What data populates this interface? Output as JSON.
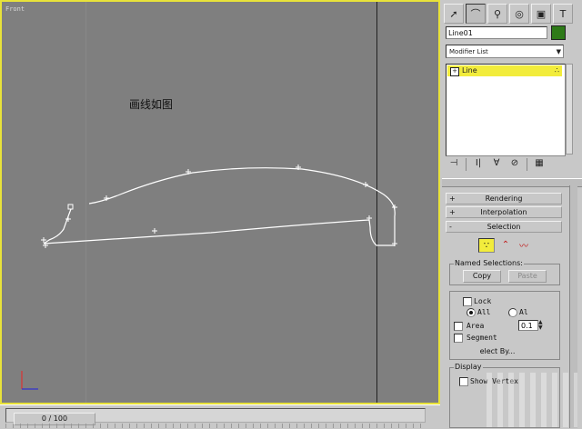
{
  "viewport": {
    "label": "Front",
    "annotation": "画线如图",
    "axis_x": "x",
    "axis_y": "y"
  },
  "timeline": {
    "frame_label": "0 / 100"
  },
  "command_panel": {
    "tabs": [
      {
        "name": "create-tab",
        "icon": "pointer-icon",
        "glyph": "➚"
      },
      {
        "name": "modify-tab",
        "icon": "modify-curve-icon",
        "glyph": "⌒"
      },
      {
        "name": "hierarchy-tab",
        "icon": "hierarchy-icon",
        "glyph": "⚲"
      },
      {
        "name": "motion-tab",
        "icon": "motion-icon",
        "glyph": "◎"
      },
      {
        "name": "display-tab",
        "icon": "display-monitor-icon",
        "glyph": "▣"
      },
      {
        "name": "utilities-tab",
        "icon": "hammer-icon",
        "glyph": "T"
      }
    ],
    "object_name": "Line01",
    "object_color": "#2e7a18",
    "modifier_list": "Modifier List",
    "stack_item": "Line",
    "stack_buttons": [
      "⊣",
      "I|",
      "∀",
      "⊘",
      "▦"
    ]
  },
  "rollouts": {
    "rendering": "Rendering",
    "interpolation": "Interpolation",
    "selection": "Selection"
  },
  "selection": {
    "named_selections_title": "Named Selections:",
    "copy_label": "Copy",
    "paste_label": "Paste",
    "lock_label": "Lock",
    "radio_all": "All",
    "radio_a": "Al",
    "area_label": "Area",
    "area_value": "0.1",
    "segment_label": "Segment",
    "select_by_label": "elect By...",
    "display_title": "Display",
    "show_vertex_label": "Show Vertex"
  },
  "colors": {
    "viewport_bg": "#7f7f7f",
    "active_border": "#e8e23a",
    "stack_highlight": "#f2ec3c",
    "curve": "#ffffff"
  }
}
